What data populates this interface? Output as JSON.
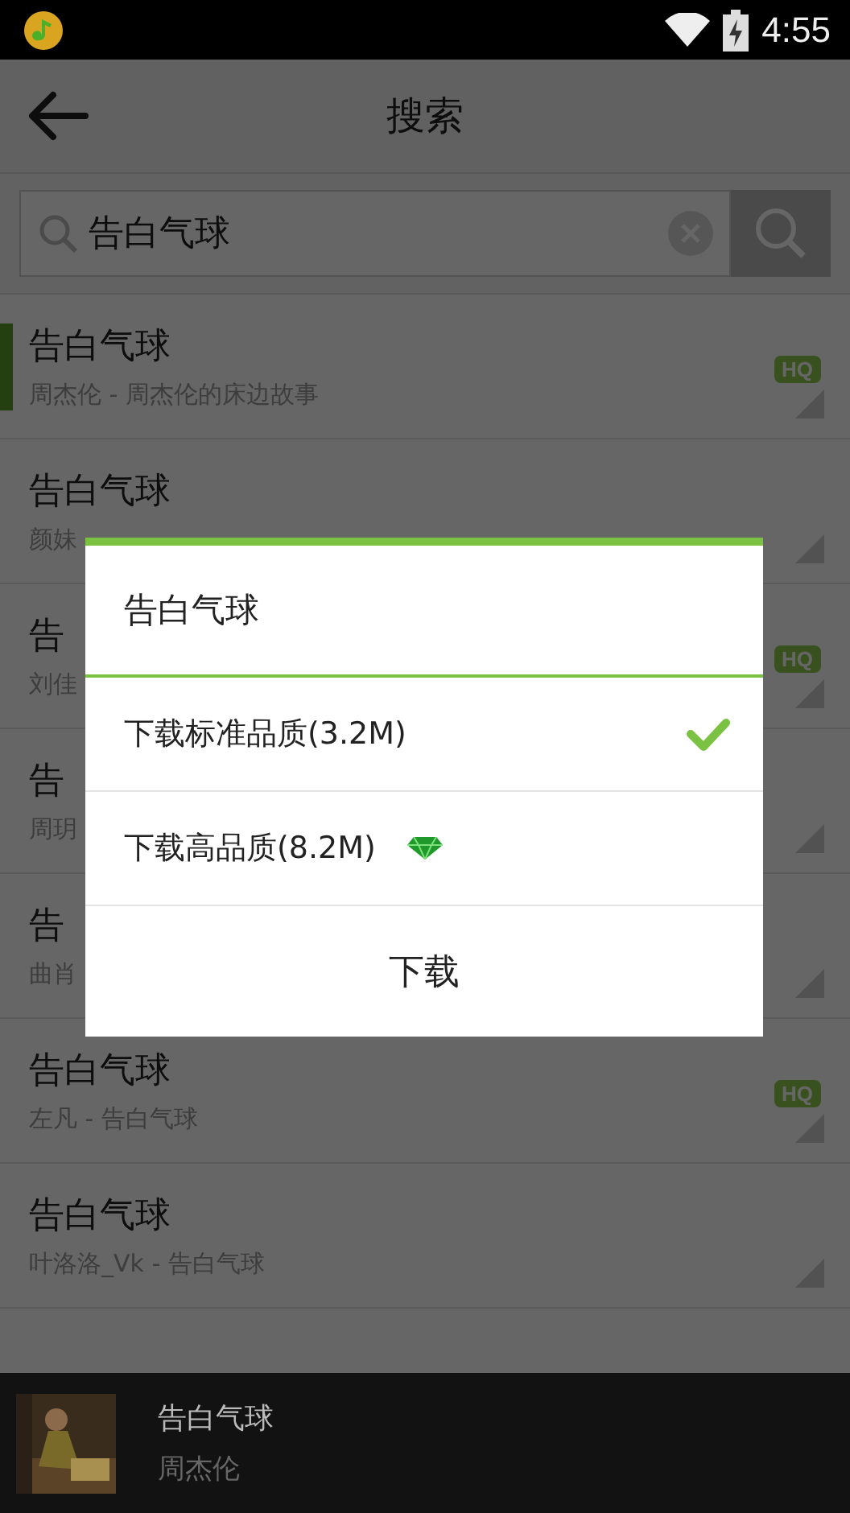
{
  "status_bar": {
    "time": "4:55"
  },
  "header": {
    "title": "搜索"
  },
  "search": {
    "value": "告白气球"
  },
  "results": [
    {
      "title": "告白气球",
      "subtitle": "周杰伦 - 周杰伦的床边故事",
      "badge": "HQ",
      "playing": true
    },
    {
      "title": "告白气球",
      "subtitle": "颜妹",
      "playing": false
    },
    {
      "title": "告",
      "subtitle": "刘佳",
      "badge": "HQ",
      "playing": false
    },
    {
      "title": "告",
      "subtitle": "周玥",
      "playing": false
    },
    {
      "title": "告",
      "subtitle": "曲肖",
      "playing": false
    },
    {
      "title": "告白气球",
      "subtitle": "左凡 - 告白气球",
      "badge": "HQ",
      "playing": false
    },
    {
      "title": "告白气球",
      "subtitle": "叶洛洛_Vk - 告白气球",
      "playing": false
    }
  ],
  "dialog": {
    "title": "告白气球",
    "options": [
      {
        "label": "下载标准品质(3.2M)",
        "selected": true,
        "premium": false
      },
      {
        "label": "下载高品质(8.2M)",
        "selected": false,
        "premium": true
      }
    ],
    "button": "下载"
  },
  "player": {
    "title": "告白气球",
    "artist": "周杰伦"
  }
}
